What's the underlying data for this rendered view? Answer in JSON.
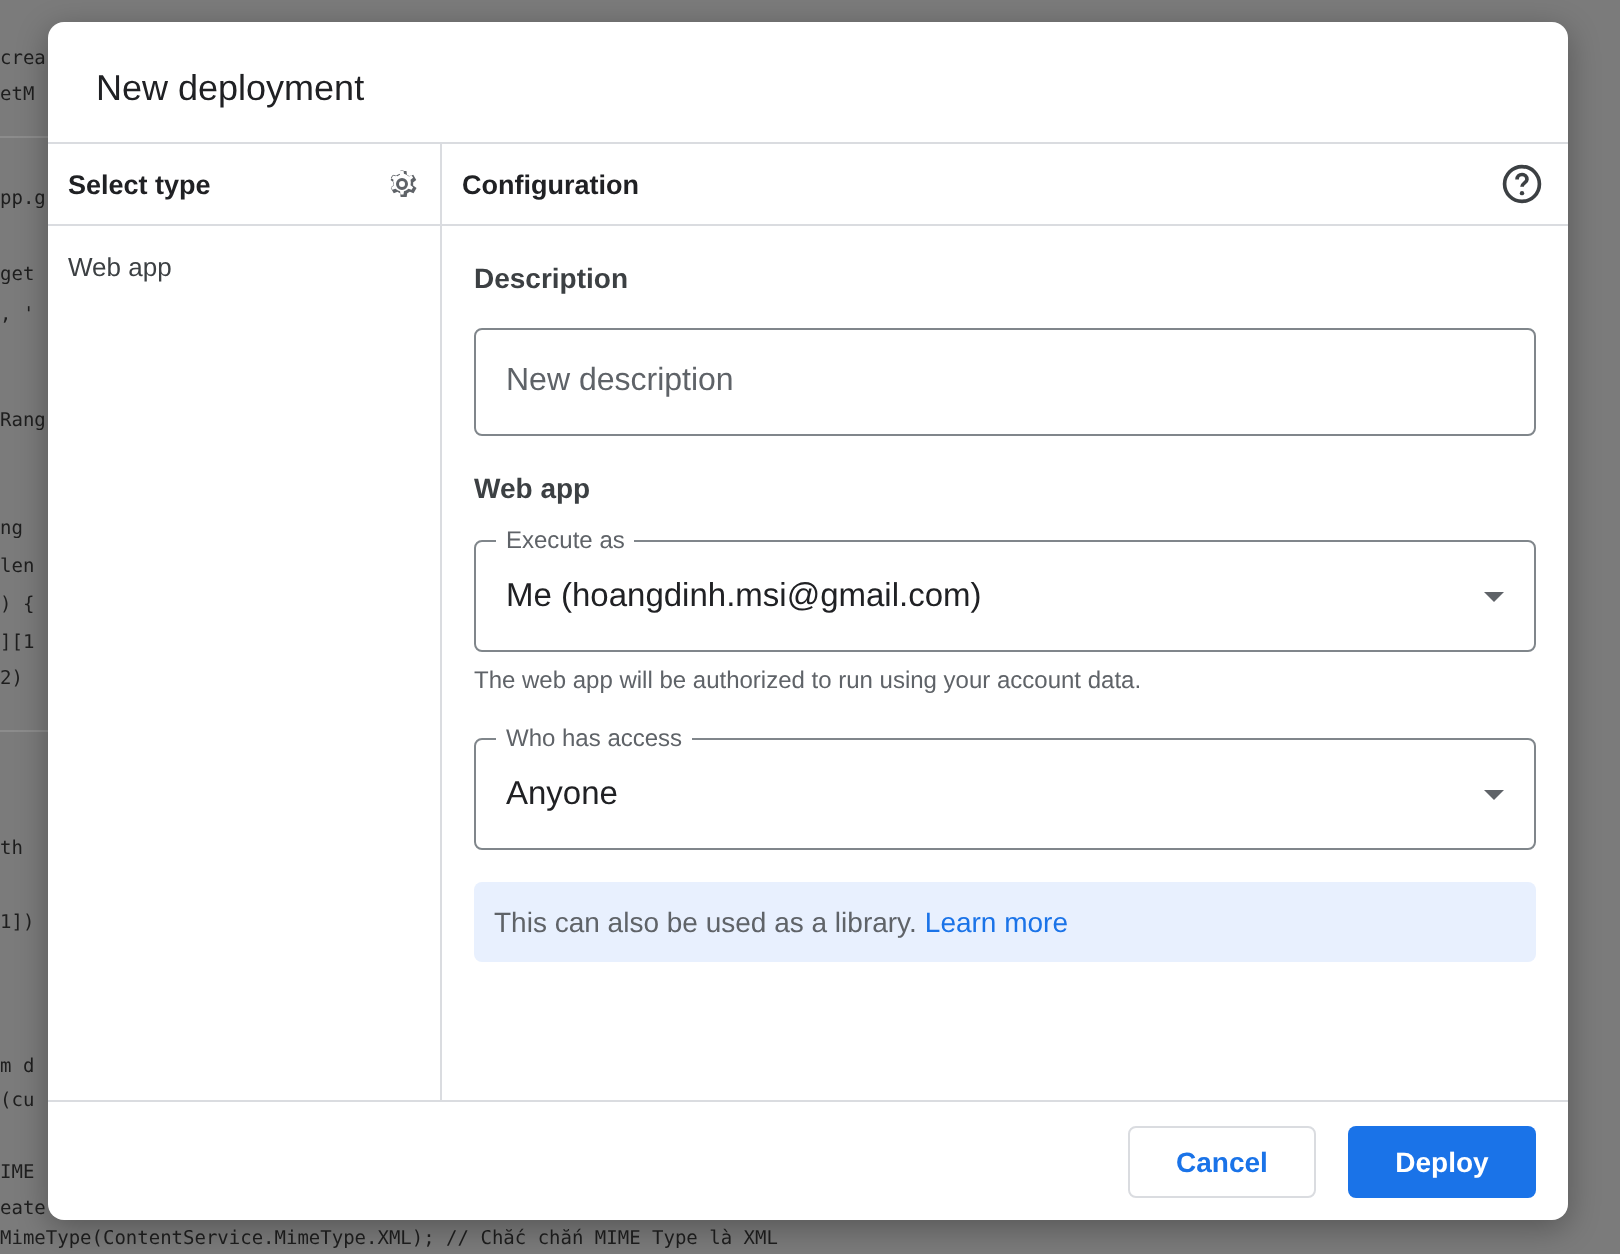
{
  "background_code": {
    "lines": [
      "crea",
      "etM",
      "pp.g",
      "get",
      ", '",
      "Rang",
      "ng",
      "len",
      ") {",
      "][1",
      "2)",
      "th",
      "1])",
      "m d",
      "(cu",
      "IME",
      "eate",
      "MimeType(ContentService.MimeType.XML);  // Chắc chắn MIME Type là XML"
    ]
  },
  "dialog": {
    "title": "New deployment",
    "sidebar": {
      "heading": "Select type",
      "items": [
        {
          "label": "Web app",
          "selected": false
        }
      ]
    },
    "config": {
      "heading": "Configuration",
      "description": {
        "heading": "Description",
        "field": {
          "placeholder": "New description"
        }
      },
      "web_app": {
        "heading": "Web app",
        "execute_as": {
          "label": "Execute as",
          "value": "Me (hoangdinh.msi@gmail.com)",
          "helper": "The web app will be authorized to run using your account data."
        },
        "access": {
          "label": "Who has access",
          "value": "Anyone"
        }
      },
      "info": {
        "text": "This can also be used as a library.",
        "link": "Learn more"
      }
    },
    "buttons": [
      {
        "label": "Cancel",
        "kind": "secondary"
      },
      {
        "label": "Deploy",
        "kind": "primary"
      }
    ]
  }
}
